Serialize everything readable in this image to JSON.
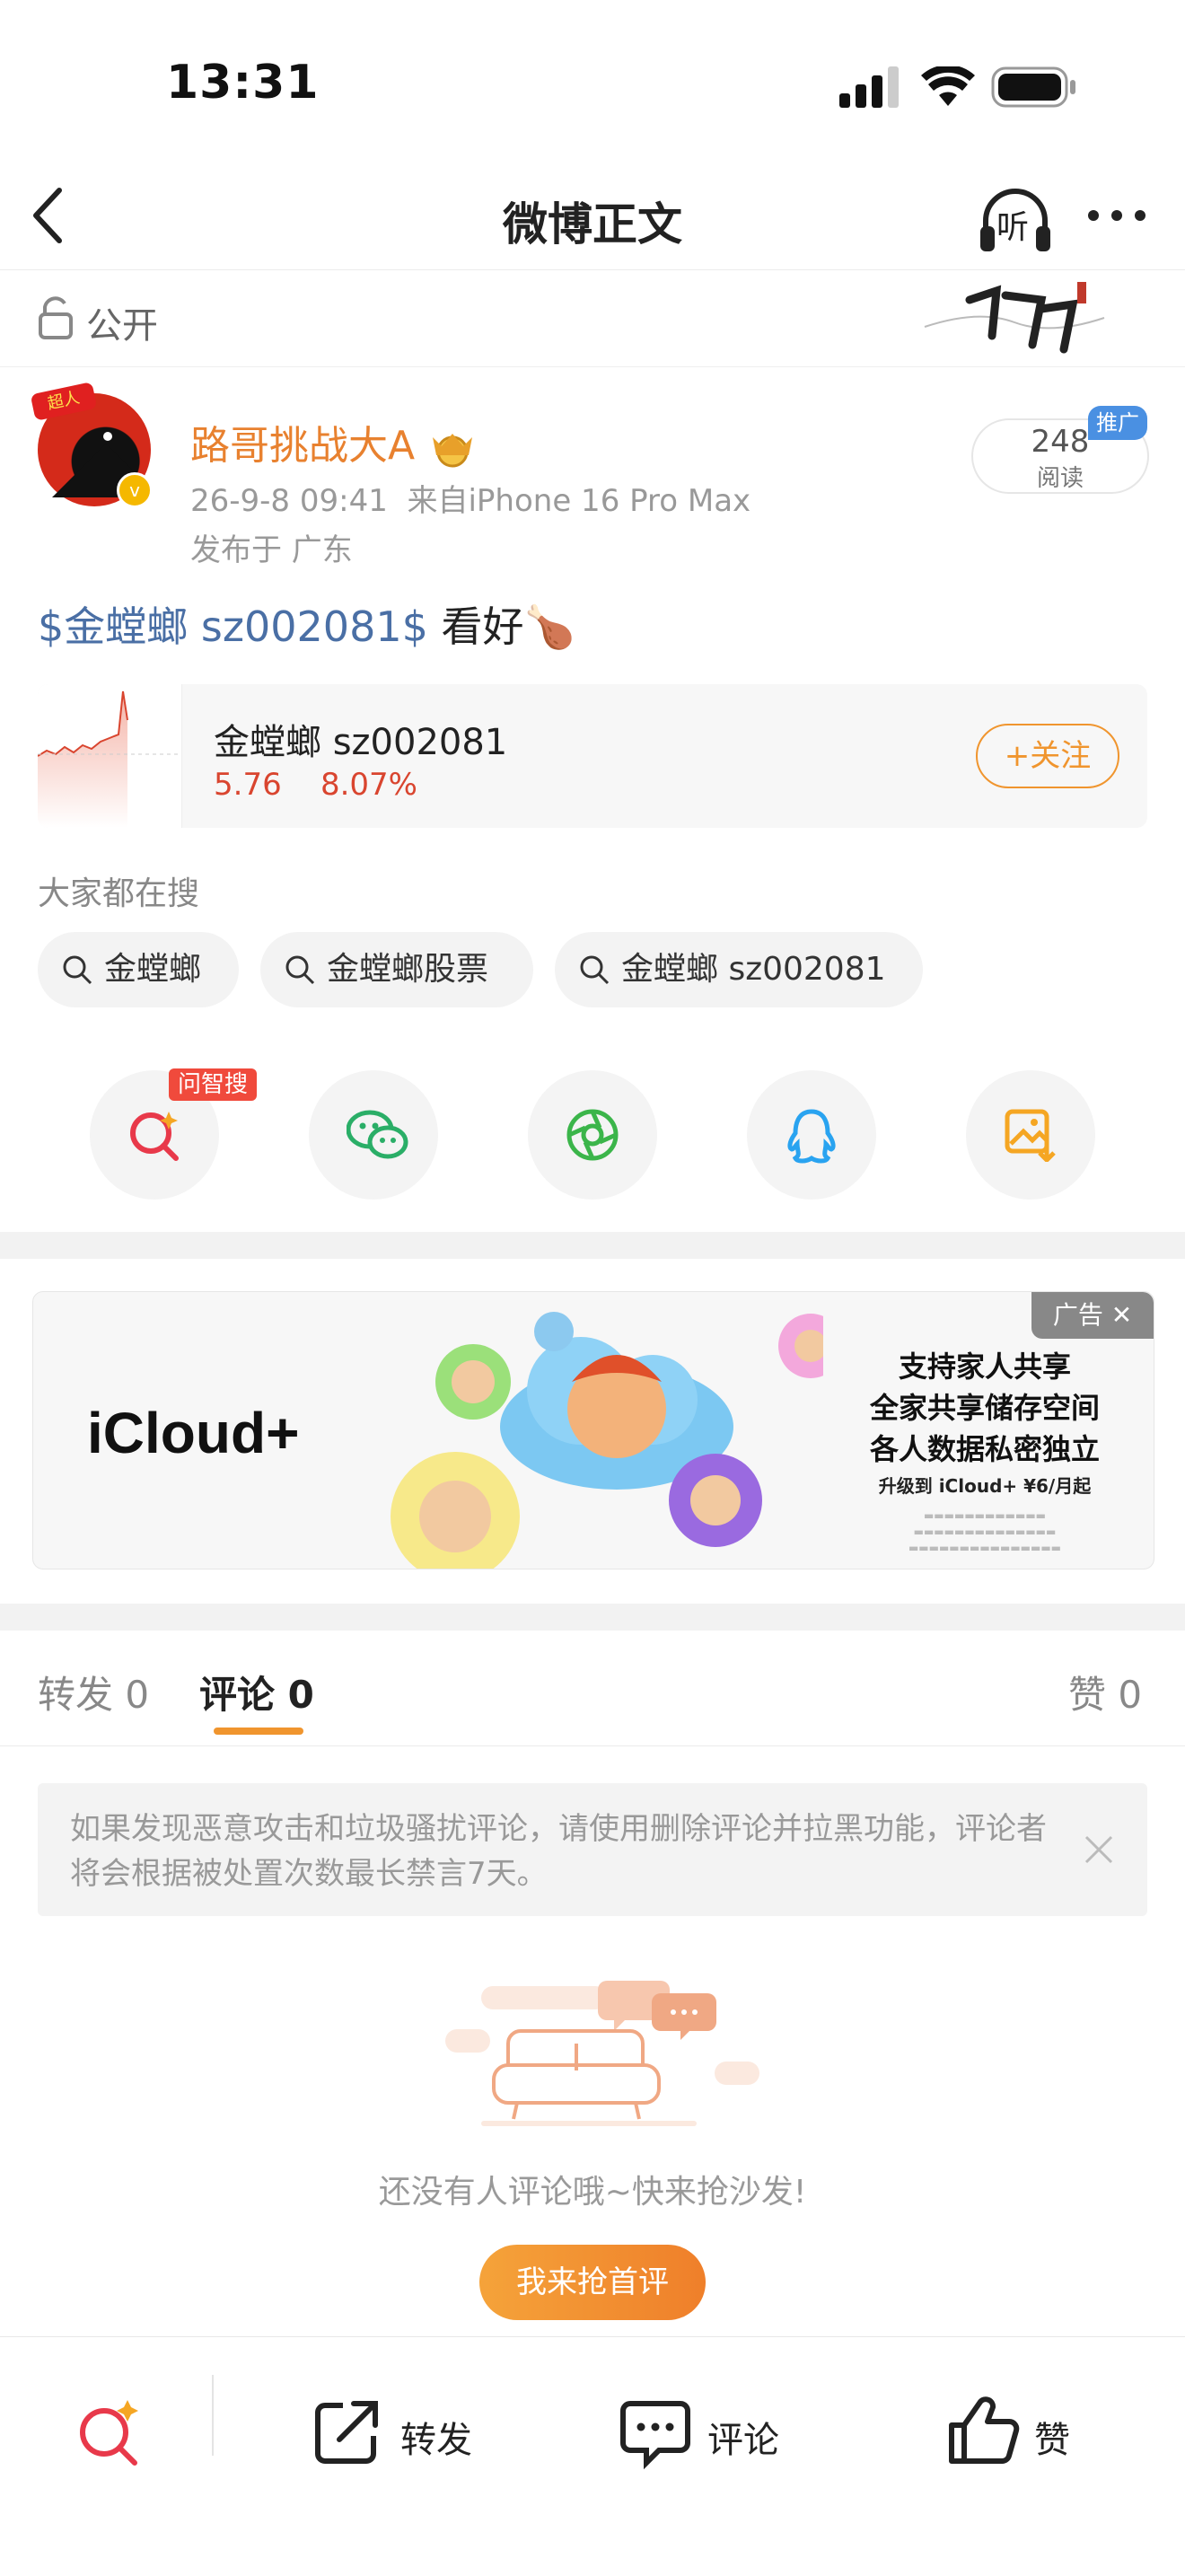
{
  "status_bar": {
    "time": "13:31"
  },
  "nav": {
    "title": "微博正文",
    "listen_label": "听"
  },
  "visibility": {
    "label": "公开"
  },
  "post": {
    "author": "路哥挑战大A",
    "avatar_badge": "超人",
    "time": "26-9-8 09:41",
    "source": "来自iPhone 16 Pro Max",
    "location": "发布于 广东",
    "read_count": "248",
    "read_label": "阅读",
    "promo_tag": "推广",
    "text_link": "$金螳螂 sz002081$",
    "text_rest": " 看好🍗"
  },
  "stock": {
    "name": "金螳螂 sz002081",
    "price": "5.76",
    "change": "8.07%",
    "follow_label": "+关注"
  },
  "search": {
    "title": "大家都在搜",
    "chips": [
      "金螳螂",
      "金螳螂股票",
      "金螳螂 sz002081"
    ]
  },
  "share": {
    "ai_badge": "问智搜",
    "icons": [
      "ai-search-icon",
      "wechat-icon",
      "moments-icon",
      "qq-icon",
      "save-image-icon"
    ]
  },
  "ad": {
    "brand": "iCloud+",
    "lines": [
      "支持家人共享",
      "全家共享储存空间",
      "各人数据私密独立"
    ],
    "sub": "升级到 iCloud+ ¥6/月起",
    "tag": "广告 ✕"
  },
  "tabs": {
    "repost": "转发 0",
    "comment": "评论 0",
    "like": "赞 0"
  },
  "notice": {
    "text": "如果发现恶意攻击和垃圾骚扰评论，请使用删除评论并拉黑功能，评论者将会根据被处置次数最长禁言7天。"
  },
  "empty": {
    "text": "还没有人评论哦~快来抢沙发!",
    "button": "我来抢首评"
  },
  "bottom_bar": {
    "repost": "转发",
    "comment": "评论",
    "like": "赞"
  },
  "colors": {
    "accent": "#f0952e",
    "link": "#4a6fa5",
    "up": "#d9452f",
    "author": "#e8812f"
  }
}
